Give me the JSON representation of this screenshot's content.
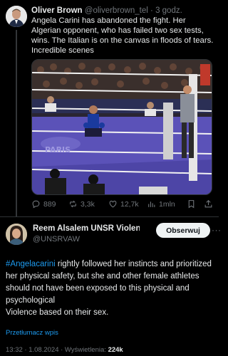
{
  "tweet1": {
    "author_name": "Oliver Brown",
    "author_handle": "@oliverbrown_tel",
    "separator": "·",
    "time": "3 godz.",
    "text": "Angela Carini has abandoned the fight. Her Algerian opponent, who has failed two sex tests, wins. The Italian is on the canvas in floods of tears. Incredible scenes",
    "actions": {
      "replies": "889",
      "retweets": "3,3k",
      "likes": "12,7k",
      "views": "1mln"
    }
  },
  "tweet2": {
    "author_name": "Reem Alsalem UNSR Violenc...",
    "author_handle": "@UNSRVAW",
    "follow_label": "Obserwuj",
    "more_label": "···",
    "hashtag": "#Angelacarini",
    "text_rest": " rightly followed her instincts and prioritized her physical safety, but she and other female athletes should not have been exposed to this physical and psychological",
    "text_line2": "Violence based on their sex.",
    "translate_label": "Przetłumacz wpis",
    "timestamp": "13:32 · 1.08.2024 · Wyświetlenia: ",
    "views": "224k"
  },
  "icons": {
    "reply": "reply-icon",
    "retweet": "retweet-icon",
    "like": "heart-icon",
    "views": "views-icon",
    "bookmark": "bookmark-icon",
    "share": "share-icon",
    "verified": "verified-badge-icon"
  },
  "colors": {
    "background": "#000000",
    "text": "#e7e9ea",
    "muted": "#71767b",
    "link": "#1d9bf0",
    "ring_canvas": "#5b52b8",
    "follow_button": "#eff3f4"
  }
}
